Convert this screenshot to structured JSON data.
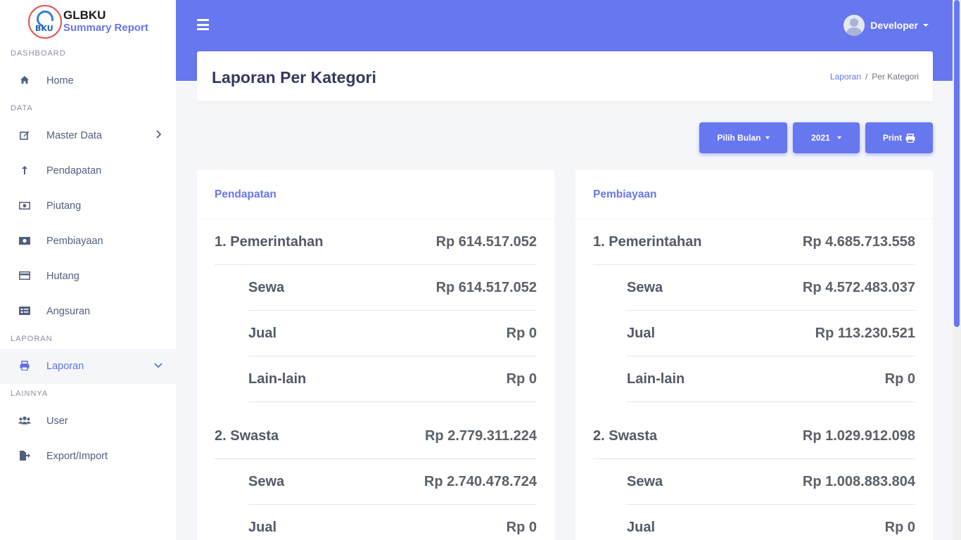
{
  "brand": {
    "name": "GLBKU",
    "subtitle": "Summary Report",
    "logo_text": "BKU"
  },
  "sidebar": {
    "sections": [
      {
        "heading": "DASHBOARD",
        "items": [
          {
            "label": "Home",
            "icon": "home-icon"
          }
        ]
      },
      {
        "heading": "DATA",
        "items": [
          {
            "label": "Master Data",
            "icon": "edit-icon"
          },
          {
            "label": "Pendapatan",
            "icon": "arrow-up-icon"
          },
          {
            "label": "Piutang",
            "icon": "money-bill-icon"
          },
          {
            "label": "Pembiayaan",
            "icon": "money-bill-wave-icon"
          },
          {
            "label": "Hutang",
            "icon": "credit-card-icon"
          },
          {
            "label": "Angsuran",
            "icon": "id-card-icon"
          }
        ]
      },
      {
        "heading": "LAPORAN",
        "items": [
          {
            "label": "Laporan",
            "icon": "print-icon"
          }
        ]
      },
      {
        "heading": "LAINNYA",
        "items": [
          {
            "label": "User",
            "icon": "users-icon"
          },
          {
            "label": "Export/Import",
            "icon": "file-export-icon"
          }
        ]
      }
    ],
    "active_item": "Laporan"
  },
  "topbar": {
    "user_name": "Developer"
  },
  "header": {
    "title": "Laporan Per Kategori",
    "breadcrumb": [
      "Laporan",
      "Per Kategori"
    ]
  },
  "actions": {
    "month_label": "Pilih Bulan",
    "year_label": "2021",
    "print_label": "Print"
  },
  "pendapatan": {
    "title": "Pendapatan",
    "rows": [
      {
        "label": "1. Pemerintahan",
        "amount": "Rp 614.517.052"
      },
      {
        "label": "Sewa",
        "amount": "Rp 614.517.052"
      },
      {
        "label": "Jual",
        "amount": "Rp 0"
      },
      {
        "label": "Lain-lain",
        "amount": "Rp 0"
      },
      {
        "label": "2. Swasta",
        "amount": "Rp 2.779.311.224"
      },
      {
        "label": "Sewa",
        "amount": "Rp 2.740.478.724"
      },
      {
        "label": "Jual",
        "amount": "Rp 0"
      }
    ]
  },
  "pembiayaan": {
    "title": "Pembiayaan",
    "rows": [
      {
        "label": "1. Pemerintahan",
        "amount": "Rp 4.685.713.558"
      },
      {
        "label": "Sewa",
        "amount": "Rp 4.572.483.037"
      },
      {
        "label": "Jual",
        "amount": "Rp 113.230.521"
      },
      {
        "label": "Lain-lain",
        "amount": "Rp 0"
      },
      {
        "label": "2. Swasta",
        "amount": "Rp 1.029.912.098"
      },
      {
        "label": "Sewa",
        "amount": "Rp 1.008.883.804"
      },
      {
        "label": "Jual",
        "amount": "Rp 0"
      }
    ]
  },
  "colors": {
    "primary": "#6777ef",
    "text": "#525f7f",
    "background": "#f5f6fa"
  }
}
